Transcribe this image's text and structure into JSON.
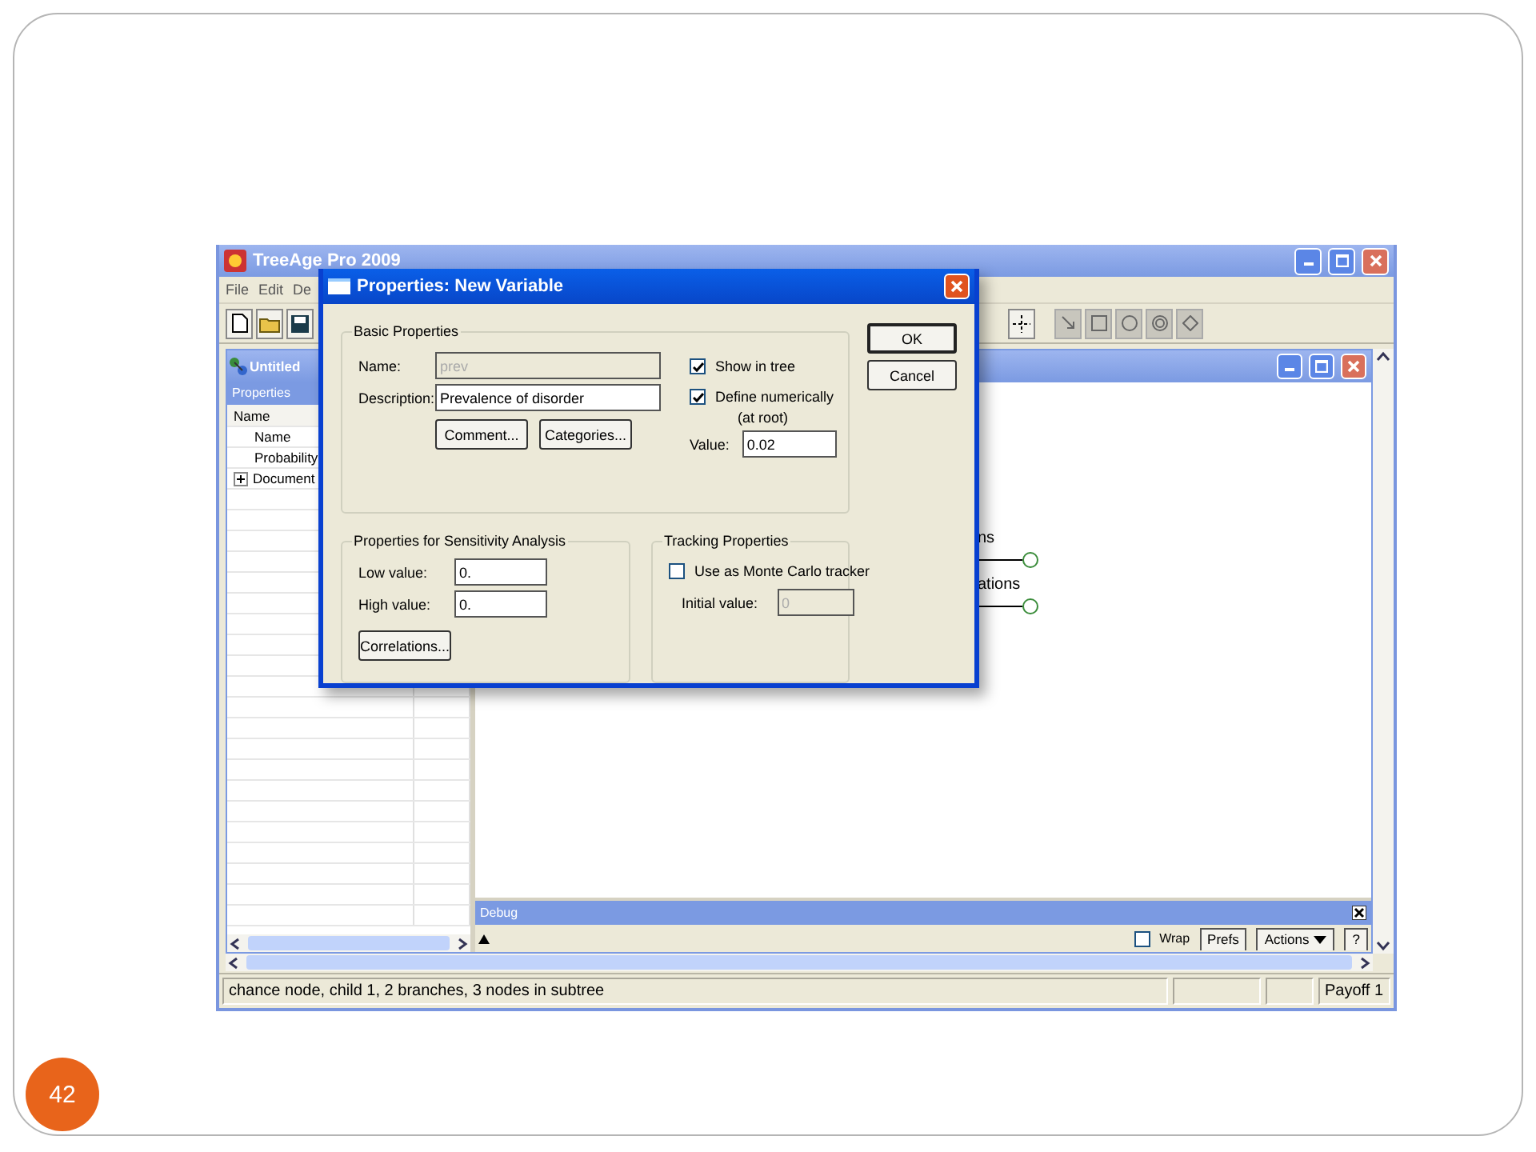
{
  "slide": {
    "page_number": "42"
  },
  "app": {
    "title": "TreeAge Pro 2009",
    "menu": [
      "File",
      "Edit",
      "De"
    ],
    "document": {
      "title": "Untitled",
      "panel_title": "Properties",
      "column": "Name",
      "rows": [
        {
          "label": "Name",
          "kind": "item"
        },
        {
          "label": "Probability",
          "kind": "item"
        },
        {
          "label": "Document",
          "kind": "folder"
        }
      ]
    },
    "tree_labels": [
      "ns",
      "ations"
    ],
    "debug": {
      "title": "Debug",
      "wrap_label": "Wrap",
      "wrap": false,
      "buttons": [
        "Prefs",
        "Actions",
        "?"
      ]
    },
    "status": {
      "message": "chance node, child 1, 2 branches, 3 nodes in subtree",
      "payoff": "Payoff 1"
    }
  },
  "dialog": {
    "title": "Properties: New Variable",
    "basic": {
      "legend": "Basic Properties",
      "name_label": "Name:",
      "name": "prev",
      "name_disabled": true,
      "description_label": "Description:",
      "description": "Prevalence of disorder",
      "buttons": [
        "Comment...",
        "Categories..."
      ],
      "show_in_tree": {
        "label": "Show in tree",
        "checked": true
      },
      "define_numerically": {
        "label": "Define numerically",
        "note": "(at root)",
        "checked": true
      },
      "value_label": "Value:",
      "value": "0.02"
    },
    "actions": [
      "OK",
      "Cancel"
    ],
    "sensitivity": {
      "legend": "Properties for Sensitivity Analysis",
      "low_label": "Low value:",
      "low": "0.",
      "high_label": "High value:",
      "high": "0.",
      "button": "Correlations..."
    },
    "tracking": {
      "legend": "Tracking Properties",
      "tracker": {
        "label": "Use as Monte Carlo tracker",
        "checked": false
      },
      "initial_label": "Initial value:",
      "initial": "0",
      "initial_disabled": true
    }
  }
}
